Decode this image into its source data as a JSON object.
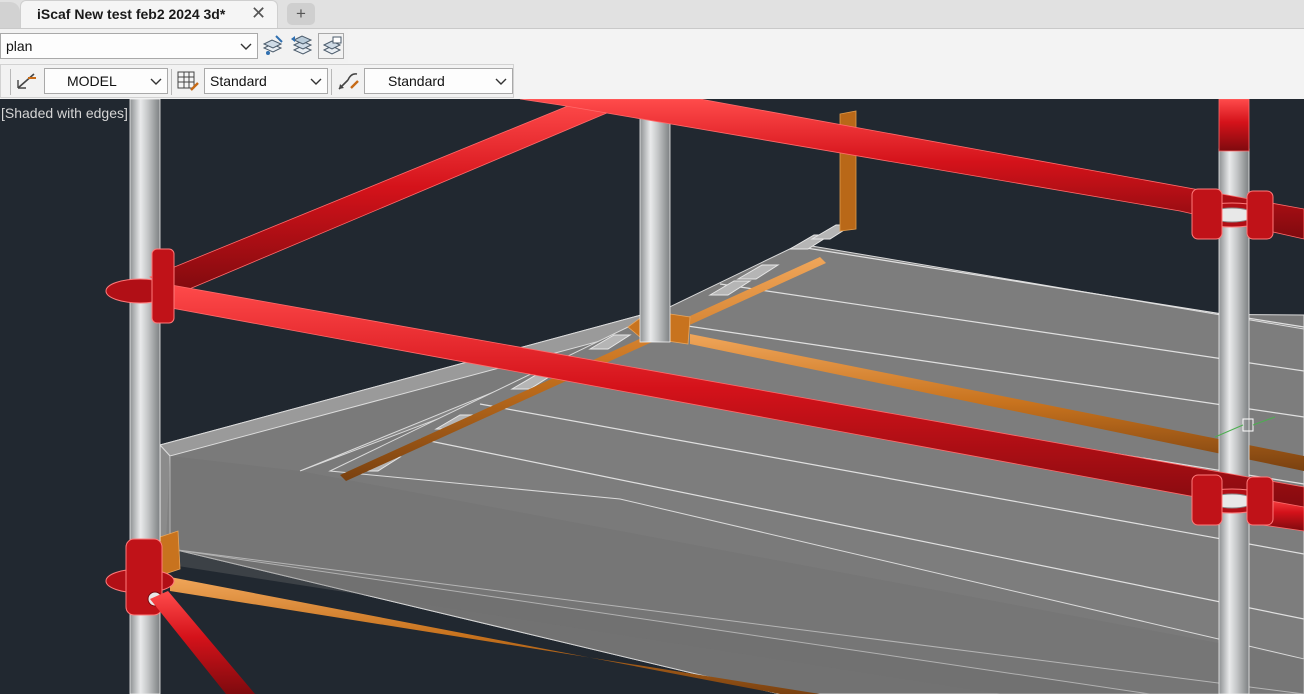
{
  "tab": {
    "title": "iScaf New test feb2 2024 3d*",
    "close_icon": "close-icon",
    "new_tab_icon": "plus-icon"
  },
  "layer_toolbar": {
    "layer_value": "plan",
    "buttons": [
      "layer-properties-icon",
      "layer-state-icon",
      "layer-previous-icon"
    ]
  },
  "style_toolbar": {
    "annotation_scale_icon": "annotation-scale-icon",
    "layout_value": "MODEL",
    "table_style_icon": "table-style-icon",
    "table_style_value": "Standard",
    "multileader_style_icon": "multileader-style-icon",
    "multileader_style_value": "Standard"
  },
  "viewport": {
    "visual_style_label": "[Shaded with edges]",
    "background": "#212830"
  },
  "colors": {
    "ledger_red": "#d4121a",
    "transom_orange": "#c8731e",
    "standard_tube": "#c9cbcc",
    "deck_gray": "#808080"
  }
}
